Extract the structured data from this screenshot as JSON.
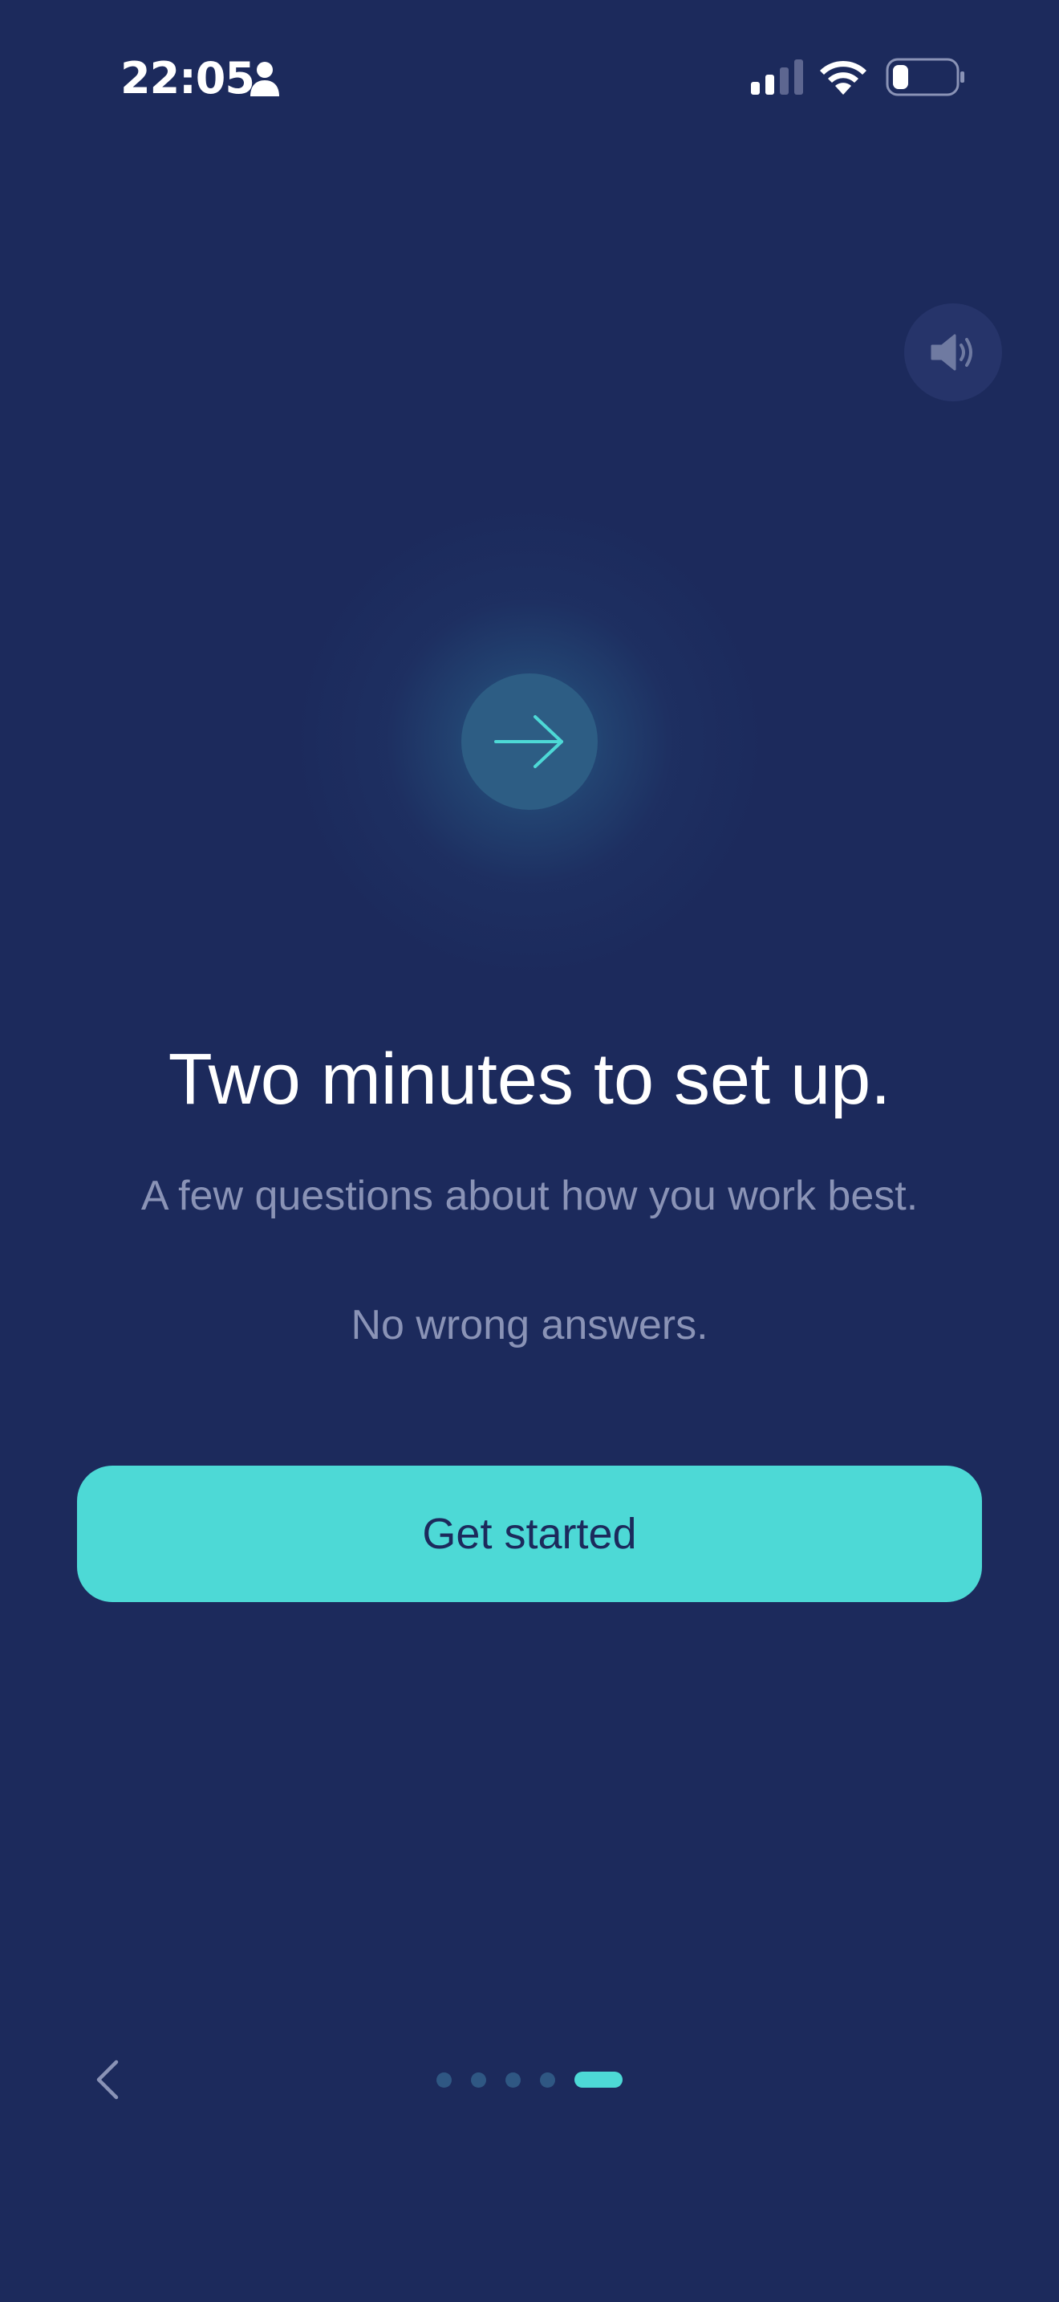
{
  "status_bar": {
    "time": "22:05",
    "icons": [
      "person-icon",
      "cellular-signal-icon",
      "wifi-icon",
      "battery-icon"
    ],
    "signal_bars_active": 2,
    "signal_bars_total": 4,
    "battery_level": 0.25
  },
  "sound_button": {
    "icon": "speaker-icon"
  },
  "hero": {
    "icon": "arrow-right-icon"
  },
  "content": {
    "headline": "Two minutes to set up.",
    "subtitle": "A few questions about how you work best.",
    "note": "No wrong answers."
  },
  "cta": {
    "label": "Get started"
  },
  "navigation": {
    "back_icon": "chevron-left-icon",
    "pages_total": 5,
    "current_page": 5
  },
  "colors": {
    "background": "#1c2a5c",
    "accent": "#4dd9d6",
    "muted_text": "#8a93b6",
    "inactive_dot": "#2f5783"
  }
}
